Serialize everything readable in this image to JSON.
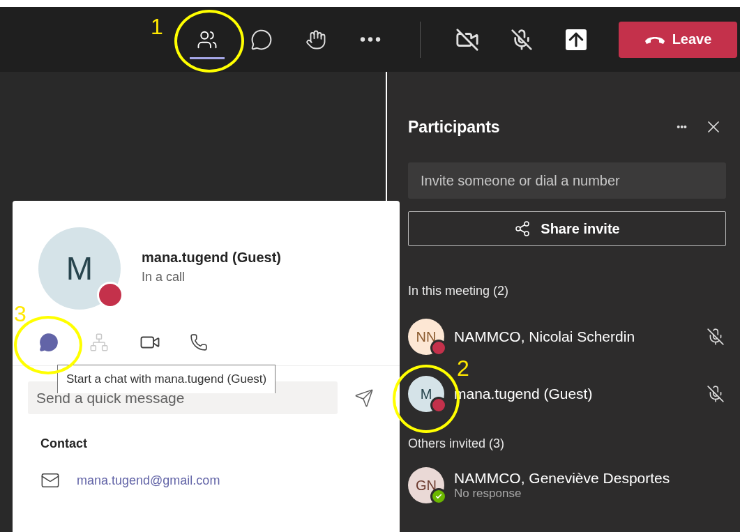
{
  "annotations": [
    {
      "label": "1"
    },
    {
      "label": "2"
    },
    {
      "label": "3"
    }
  ],
  "toolbar": {
    "items": [
      {
        "kind": "participants",
        "selected": true
      },
      {
        "kind": "chat",
        "selected": false
      },
      {
        "kind": "reactions",
        "selected": false
      },
      {
        "kind": "more",
        "selected": false
      },
      {
        "kind": "camera-off",
        "selected": false
      },
      {
        "kind": "mic-off",
        "selected": false
      },
      {
        "kind": "share",
        "selected": false
      }
    ],
    "leave": {
      "label": "Leave"
    }
  },
  "participants_panel": {
    "title": "Participants",
    "more": "•••",
    "invite": {
      "placeholder": "Invite someone or dial a number"
    },
    "share_invite": "Share invite",
    "sections": [
      {
        "title": "In this meeting (2)",
        "people": [
          {
            "initials": "NN",
            "name": "NAMMCO, Nicolai Scherdin",
            "color": "#c4314b",
            "muted": true
          },
          {
            "initials": "M",
            "name": "mana.tugend (Guest)",
            "color": "#c4314b",
            "muted": true
          }
        ]
      },
      {
        "title": "Others invited (3)",
        "people": [
          {
            "initials": "GN",
            "name": "NAMMCO, Geneviève Desportes",
            "subtitle": "No response",
            "color": "#6bb700",
            "muted": false
          }
        ]
      }
    ]
  },
  "profile_card": {
    "initials": "M",
    "name": "mana.tugend (Guest)",
    "status": "In a call",
    "actions": [
      {
        "kind": "chat",
        "selected": true,
        "disabled": false
      },
      {
        "kind": "org",
        "selected": false,
        "disabled": true
      },
      {
        "kind": "video",
        "selected": false,
        "disabled": false
      },
      {
        "kind": "call",
        "selected": false,
        "disabled": false
      }
    ],
    "tooltip": "Start a chat with mana.tugend (Guest)",
    "message": {
      "placeholder": "Send a quick message"
    },
    "contact_heading": "Contact",
    "email": "mana.tugend@gmail.com"
  }
}
